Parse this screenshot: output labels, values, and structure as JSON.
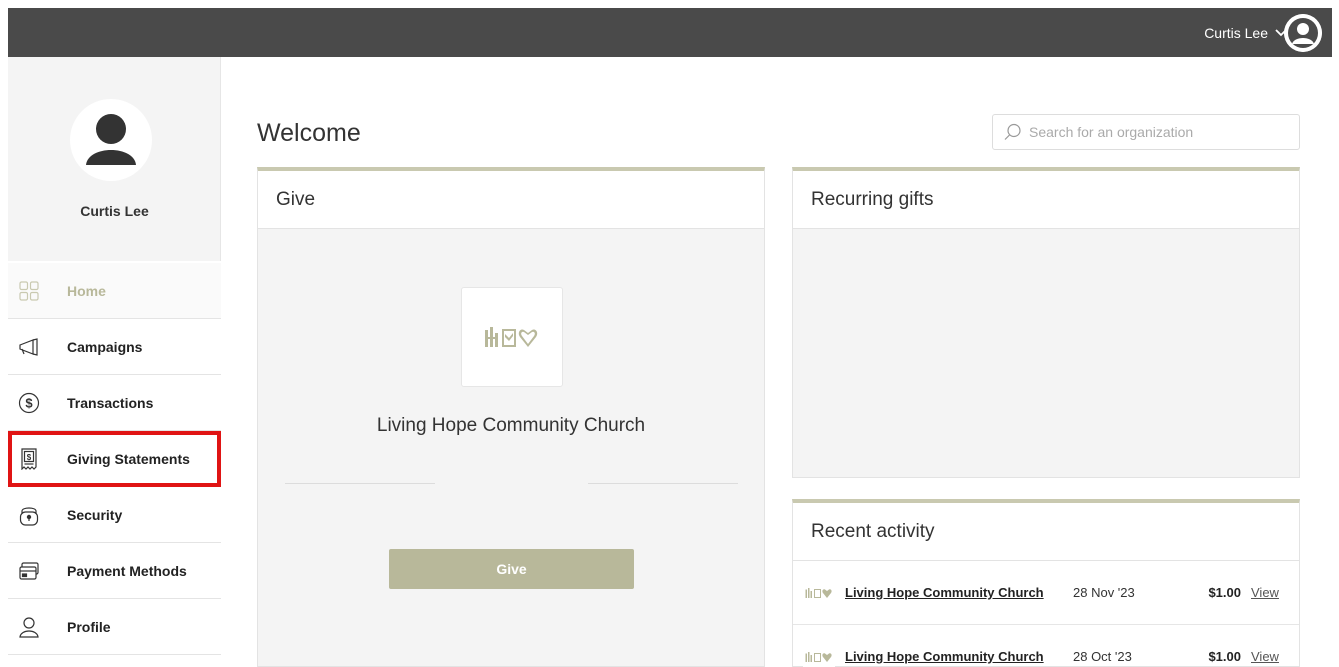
{
  "topbar": {
    "user_name": "Curtis Lee"
  },
  "sidebar": {
    "profile_name": "Curtis Lee",
    "items": [
      {
        "label": "Home",
        "icon": "grid-icon",
        "active": true
      },
      {
        "label": "Campaigns",
        "icon": "megaphone-icon"
      },
      {
        "label": "Transactions",
        "icon": "dollar-icon"
      },
      {
        "label": "Giving Statements",
        "icon": "receipt-icon",
        "highlighted": true
      },
      {
        "label": "Security",
        "icon": "lock-icon"
      },
      {
        "label": "Payment Methods",
        "icon": "card-icon"
      },
      {
        "label": "Profile",
        "icon": "person-icon"
      }
    ]
  },
  "main": {
    "welcome": "Welcome",
    "search": {
      "placeholder": "Search for an organization"
    },
    "give_panel": {
      "title": "Give",
      "org_name": "Living Hope Community Church",
      "button_label": "Give"
    },
    "recurring_panel": {
      "title": "Recurring gifts"
    },
    "activity_panel": {
      "title": "Recent activity",
      "rows": [
        {
          "org": "Living Hope Community Church",
          "date": "28 Nov '23",
          "amount": "$1.00",
          "action": "View"
        },
        {
          "org": "Living Hope Community Church",
          "date": "28 Oct '23",
          "amount": "$1.00",
          "action": "View"
        }
      ]
    }
  },
  "colors": {
    "accent": "#b8b89a",
    "topbar": "#4a4a4a",
    "highlight": "#e01414"
  }
}
